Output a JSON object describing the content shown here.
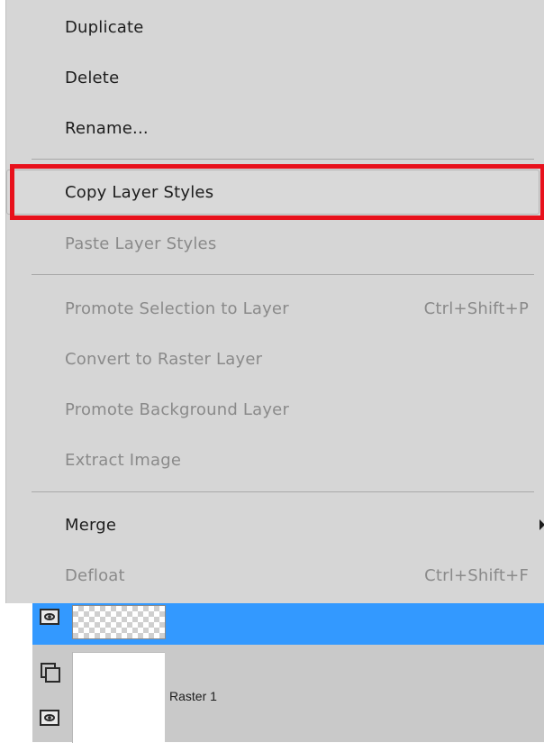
{
  "context_menu": {
    "items": [
      {
        "label": "Duplicate",
        "shortcut": "",
        "enabled": true
      },
      {
        "label": "Delete",
        "shortcut": "",
        "enabled": true
      },
      {
        "label": "Rename...",
        "shortcut": "",
        "enabled": true
      },
      {
        "label": "Copy Layer Styles",
        "shortcut": "",
        "enabled": true,
        "highlighted": true
      },
      {
        "label": "Paste Layer Styles",
        "shortcut": "",
        "enabled": false
      },
      {
        "label": "Promote Selection to Layer",
        "shortcut": "Ctrl+Shift+P",
        "enabled": false
      },
      {
        "label": "Convert to Raster Layer",
        "shortcut": "",
        "enabled": false
      },
      {
        "label": "Promote Background Layer",
        "shortcut": "",
        "enabled": false
      },
      {
        "label": "Extract Image",
        "shortcut": "",
        "enabled": false
      },
      {
        "label": "Merge",
        "shortcut": "",
        "enabled": true,
        "submenu": true
      },
      {
        "label": "Defloat",
        "shortcut": "Ctrl+Shift+F",
        "enabled": false
      }
    ]
  },
  "layers_panel": {
    "layers": [
      {
        "name": "",
        "selected": true,
        "thumbnail": "transparent-checker"
      },
      {
        "name": "Raster 1",
        "selected": false,
        "thumbnail": "white"
      }
    ],
    "icons": [
      "eye-icon",
      "group-icon"
    ]
  },
  "colors": {
    "menu_bg": "#d6d6d6",
    "highlight_outline": "#e8111c",
    "selected_layer": "#3399ff",
    "disabled_text": "#8a8a8a"
  }
}
